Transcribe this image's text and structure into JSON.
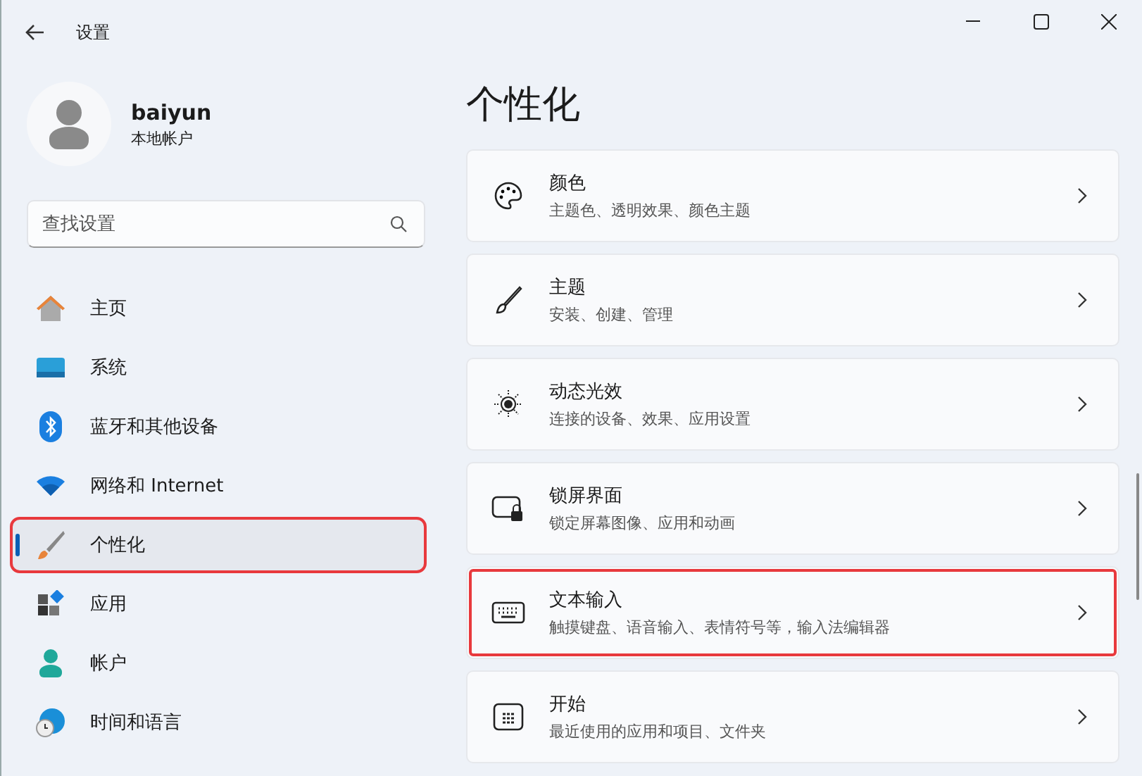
{
  "window": {
    "title": "设置"
  },
  "user": {
    "name": "baiyun",
    "account_type": "本地帐户"
  },
  "search": {
    "placeholder": "查找设置"
  },
  "sidebar": {
    "items": [
      {
        "label": "主页",
        "kind": "home",
        "selected": false,
        "highlighted": false
      },
      {
        "label": "系统",
        "kind": "system",
        "selected": false,
        "highlighted": false
      },
      {
        "label": "蓝牙和其他设备",
        "kind": "bluetooth",
        "selected": false,
        "highlighted": false
      },
      {
        "label": "网络和 Internet",
        "kind": "network",
        "selected": false,
        "highlighted": false
      },
      {
        "label": "个性化",
        "kind": "personalize",
        "selected": true,
        "highlighted": true
      },
      {
        "label": "应用",
        "kind": "apps",
        "selected": false,
        "highlighted": false
      },
      {
        "label": "帐户",
        "kind": "account",
        "selected": false,
        "highlighted": false
      },
      {
        "label": "时间和语言",
        "kind": "time",
        "selected": false,
        "highlighted": false
      }
    ]
  },
  "page": {
    "title": "个性化",
    "cards": [
      {
        "title": "颜色",
        "subtitle": "主题色、透明效果、颜色主题",
        "kind": "palette",
        "highlighted": false
      },
      {
        "title": "主题",
        "subtitle": "安装、创建、管理",
        "kind": "brush",
        "highlighted": false
      },
      {
        "title": "动态光效",
        "subtitle": "连接的设备、效果、应用设置",
        "kind": "light",
        "highlighted": false
      },
      {
        "title": "锁屏界面",
        "subtitle": "锁定屏幕图像、应用和动画",
        "kind": "lock",
        "highlighted": false
      },
      {
        "title": "文本输入",
        "subtitle": "触摸键盘、语音输入、表情符号等，输入法编辑器",
        "kind": "keyboard",
        "highlighted": true
      },
      {
        "title": "开始",
        "subtitle": "最近使用的应用和项目、文件夹",
        "kind": "start",
        "highlighted": false
      }
    ]
  }
}
